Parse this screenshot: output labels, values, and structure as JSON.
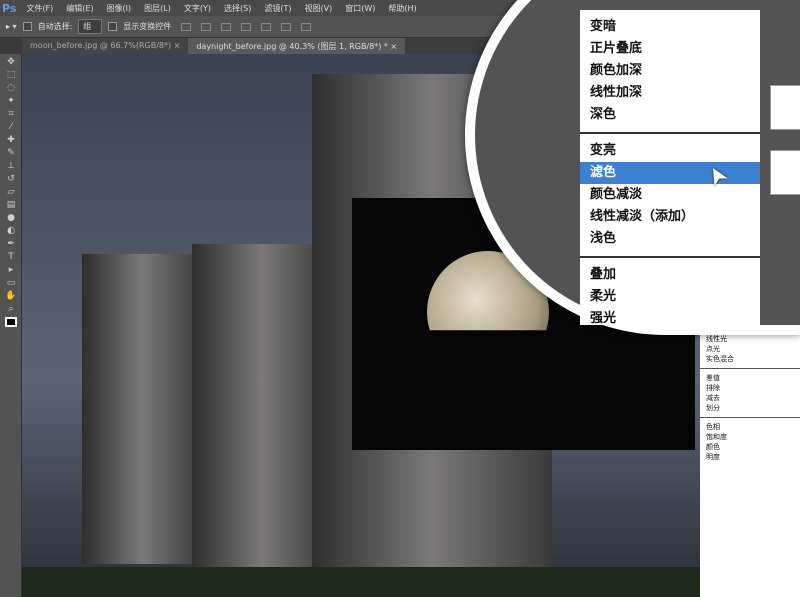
{
  "app": {
    "logo": "Ps"
  },
  "menu": [
    "文件(F)",
    "编辑(E)",
    "图像(I)",
    "图层(L)",
    "文字(Y)",
    "选择(S)",
    "滤镜(T)",
    "视图(V)",
    "窗口(W)",
    "帮助(H)"
  ],
  "options": {
    "auto_select_label": "自动选择:",
    "auto_select_value": "组",
    "show_transform_label": "显示变换控件"
  },
  "tabs": [
    {
      "label": "moon_before.jpg @ 66.7%(RGB/8*) ×"
    },
    {
      "label": "daynight_before.jpg @ 40.3% (图层 1, RGB/8*) * ×"
    }
  ],
  "blend_menu_zoomed": {
    "group1": [
      "变暗",
      "正片叠底",
      "颜色加深",
      "线性加深",
      "深色"
    ],
    "group2": [
      "变亮",
      "滤色",
      "颜色减淡",
      "线性减淡（添加）",
      "浅色"
    ],
    "group3": [
      "叠加",
      "柔光",
      "强光"
    ],
    "selected": "滤色"
  },
  "blend_menu_lower": {
    "group1": [
      "线性光",
      "点光",
      "实色混合"
    ],
    "group2": [
      "差值",
      "排除",
      "减去",
      "划分"
    ],
    "group3": [
      "色相",
      "饱和度",
      "颜色",
      "明度"
    ]
  },
  "colors": {
    "highlight": "#3d7fd0"
  }
}
